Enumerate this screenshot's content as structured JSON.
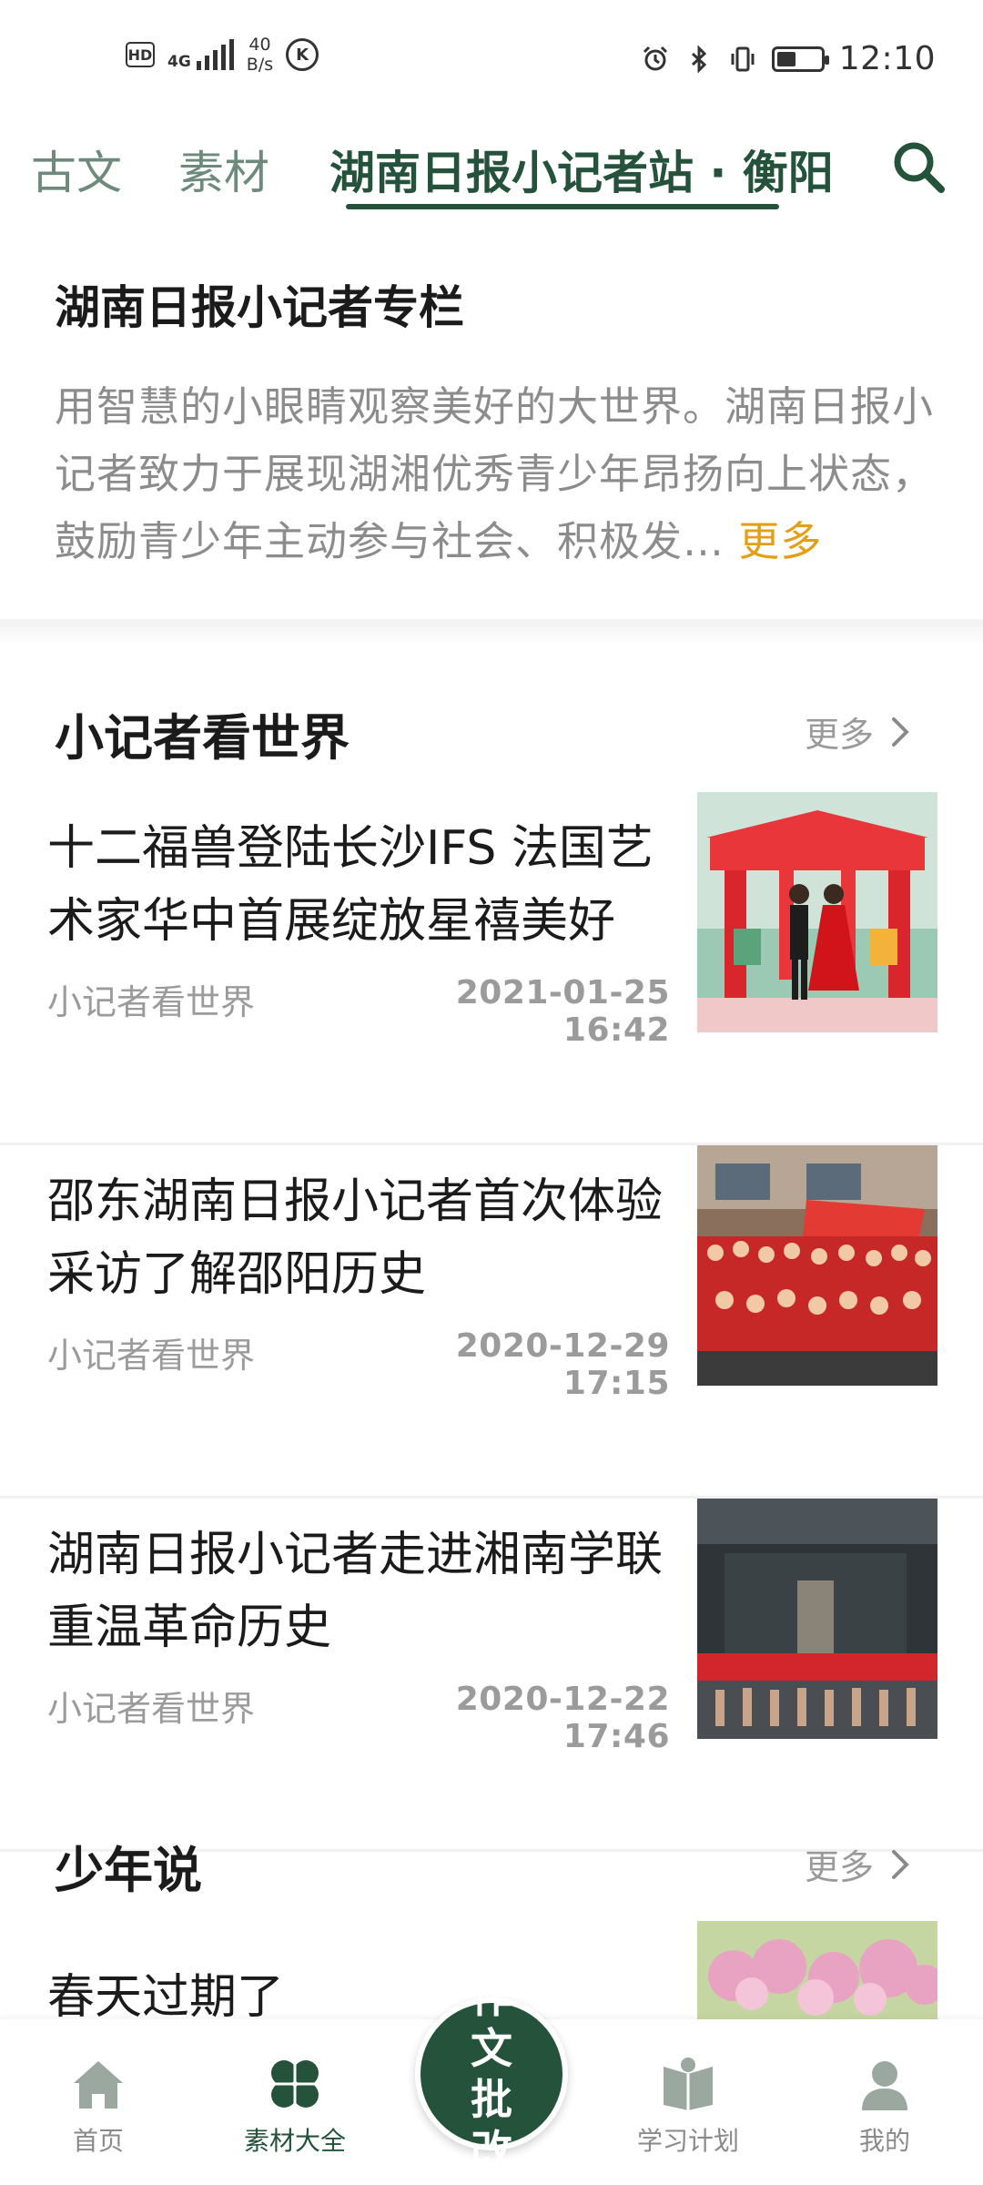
{
  "status_bar": {
    "hd": "HD",
    "network": "4G",
    "speed_value": "40",
    "speed_unit": "B/s",
    "k_badge": "K",
    "time": "12:10"
  },
  "tabs": [
    {
      "label": "古文",
      "active": false
    },
    {
      "label": "素材",
      "active": false
    },
    {
      "label": "湖南日报小记者站 · 衡阳",
      "active": true
    }
  ],
  "intro": {
    "title": "湖南日报小记者专栏",
    "description": "用智慧的小眼睛观察美好的大世界。湖南日报小记者致力于展现湖湘优秀青少年昂扬向上状态，鼓励青少年主动参与社会、积极发…",
    "more_label": "更多"
  },
  "sections": [
    {
      "title": "小记者看世界",
      "more_label": "更多",
      "articles": [
        {
          "title": "十二福兽登陆长沙IFS 法国艺术家华中首展绽放星禧美好",
          "category": "小记者看世界",
          "date": "2021-01-25 16:42"
        },
        {
          "title": "邵东湖南日报小记者首次体验采访了解邵阳历史",
          "category": "小记者看世界",
          "date": "2020-12-29 17:15"
        },
        {
          "title": "湖南日报小记者走进湘南学联重温革命历史",
          "category": "小记者看世界",
          "date": "2020-12-22 17:46"
        }
      ]
    },
    {
      "title": "少年说",
      "more_label": "更多",
      "articles": [
        {
          "title": "春天过期了",
          "category": "",
          "date": ""
        }
      ]
    }
  ],
  "bottom_nav": [
    {
      "label": "首页",
      "icon": "home-icon",
      "active": false
    },
    {
      "label": "素材大全",
      "icon": "clover-icon",
      "active": true
    },
    {
      "label": "作文批改",
      "icon": "fab",
      "active": false
    },
    {
      "label": "学习计划",
      "icon": "book-icon",
      "active": false
    },
    {
      "label": "我的",
      "icon": "user-icon",
      "active": false
    }
  ],
  "fab_label": "作文批改",
  "colors": {
    "primary": "#24523b",
    "accent": "#e2a019",
    "muted": "#8c8c8c"
  }
}
